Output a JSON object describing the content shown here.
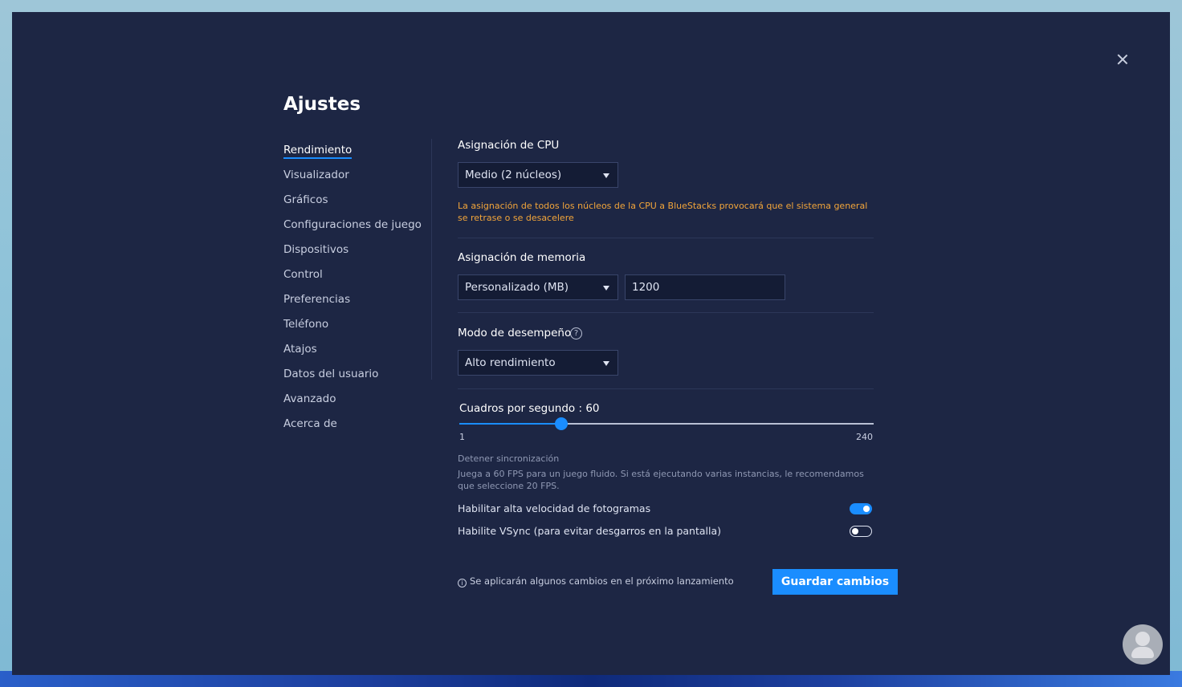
{
  "dialog": {
    "title": "Ajustes"
  },
  "sidebar": {
    "items": [
      {
        "label": "Rendimiento",
        "active": true
      },
      {
        "label": "Visualizador"
      },
      {
        "label": "Gráficos"
      },
      {
        "label": "Configuraciones de juego"
      },
      {
        "label": "Dispositivos"
      },
      {
        "label": "Control"
      },
      {
        "label": "Preferencias"
      },
      {
        "label": "Teléfono"
      },
      {
        "label": "Atajos"
      },
      {
        "label": "Datos del usuario"
      },
      {
        "label": "Avanzado"
      },
      {
        "label": "Acerca de"
      }
    ]
  },
  "cpu": {
    "label": "Asignación de CPU",
    "selected": "Medio (2 núcleos)",
    "warning": "La asignación de todos los núcleos de la CPU a BlueStacks provocará que el sistema general se retrase o se desacelere"
  },
  "memory": {
    "label": "Asignación de memoria",
    "selected": "Personalizado (MB)",
    "value": "1200"
  },
  "performance_mode": {
    "label": "Modo de desempeño",
    "help_glyph": "?",
    "selected": "Alto rendimiento"
  },
  "fps": {
    "label": "Cuadros por segundo : 60",
    "value": 60,
    "min": 1,
    "max": 240,
    "min_label": "1",
    "max_label": "240",
    "sync_title": "Detener sincronización",
    "sync_desc": "Juega a 60 FPS para un juego fluido. Si está ejecutando varias instancias, le recomendamos que seleccione 20 FPS."
  },
  "toggles": {
    "high_fps": {
      "label": "Habilitar alta velocidad de fotogramas",
      "on": true
    },
    "vsync": {
      "label": "Habilite VSync (para evitar desgarros en la pantalla)",
      "on": false
    }
  },
  "footer": {
    "info_glyph": "i",
    "info": "Se aplicarán algunos cambios en el próximo lanzamiento",
    "save_label": "Guardar cambios"
  },
  "colors": {
    "accent": "#1a8dff",
    "warning": "#f2a53a",
    "background": "#1d2644"
  },
  "icons": {
    "close": "close-icon",
    "dropdown": "chevron-down-icon",
    "help": "question-circle-icon",
    "info": "info-circle-icon"
  }
}
